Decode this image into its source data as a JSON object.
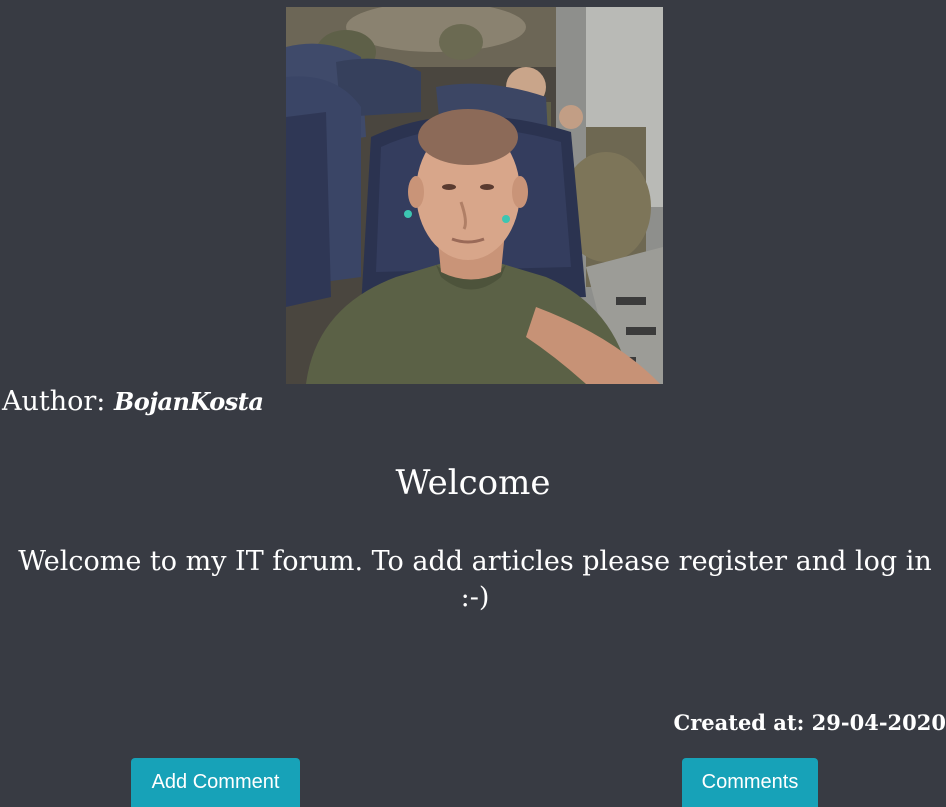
{
  "post": {
    "author_label": "Author: ",
    "author_name": "BojanKosta",
    "title": "Welcome",
    "body": "Welcome to my IT forum. To add articles please register and log in :-)",
    "created_label": "Created at: ",
    "created_date": "29-04-2020"
  },
  "actions": {
    "add_comment_label": "Add Comment",
    "comments_label": "Comments"
  },
  "colors": {
    "background": "#383b43",
    "button": "#17a2b8",
    "text": "#ffffff"
  }
}
